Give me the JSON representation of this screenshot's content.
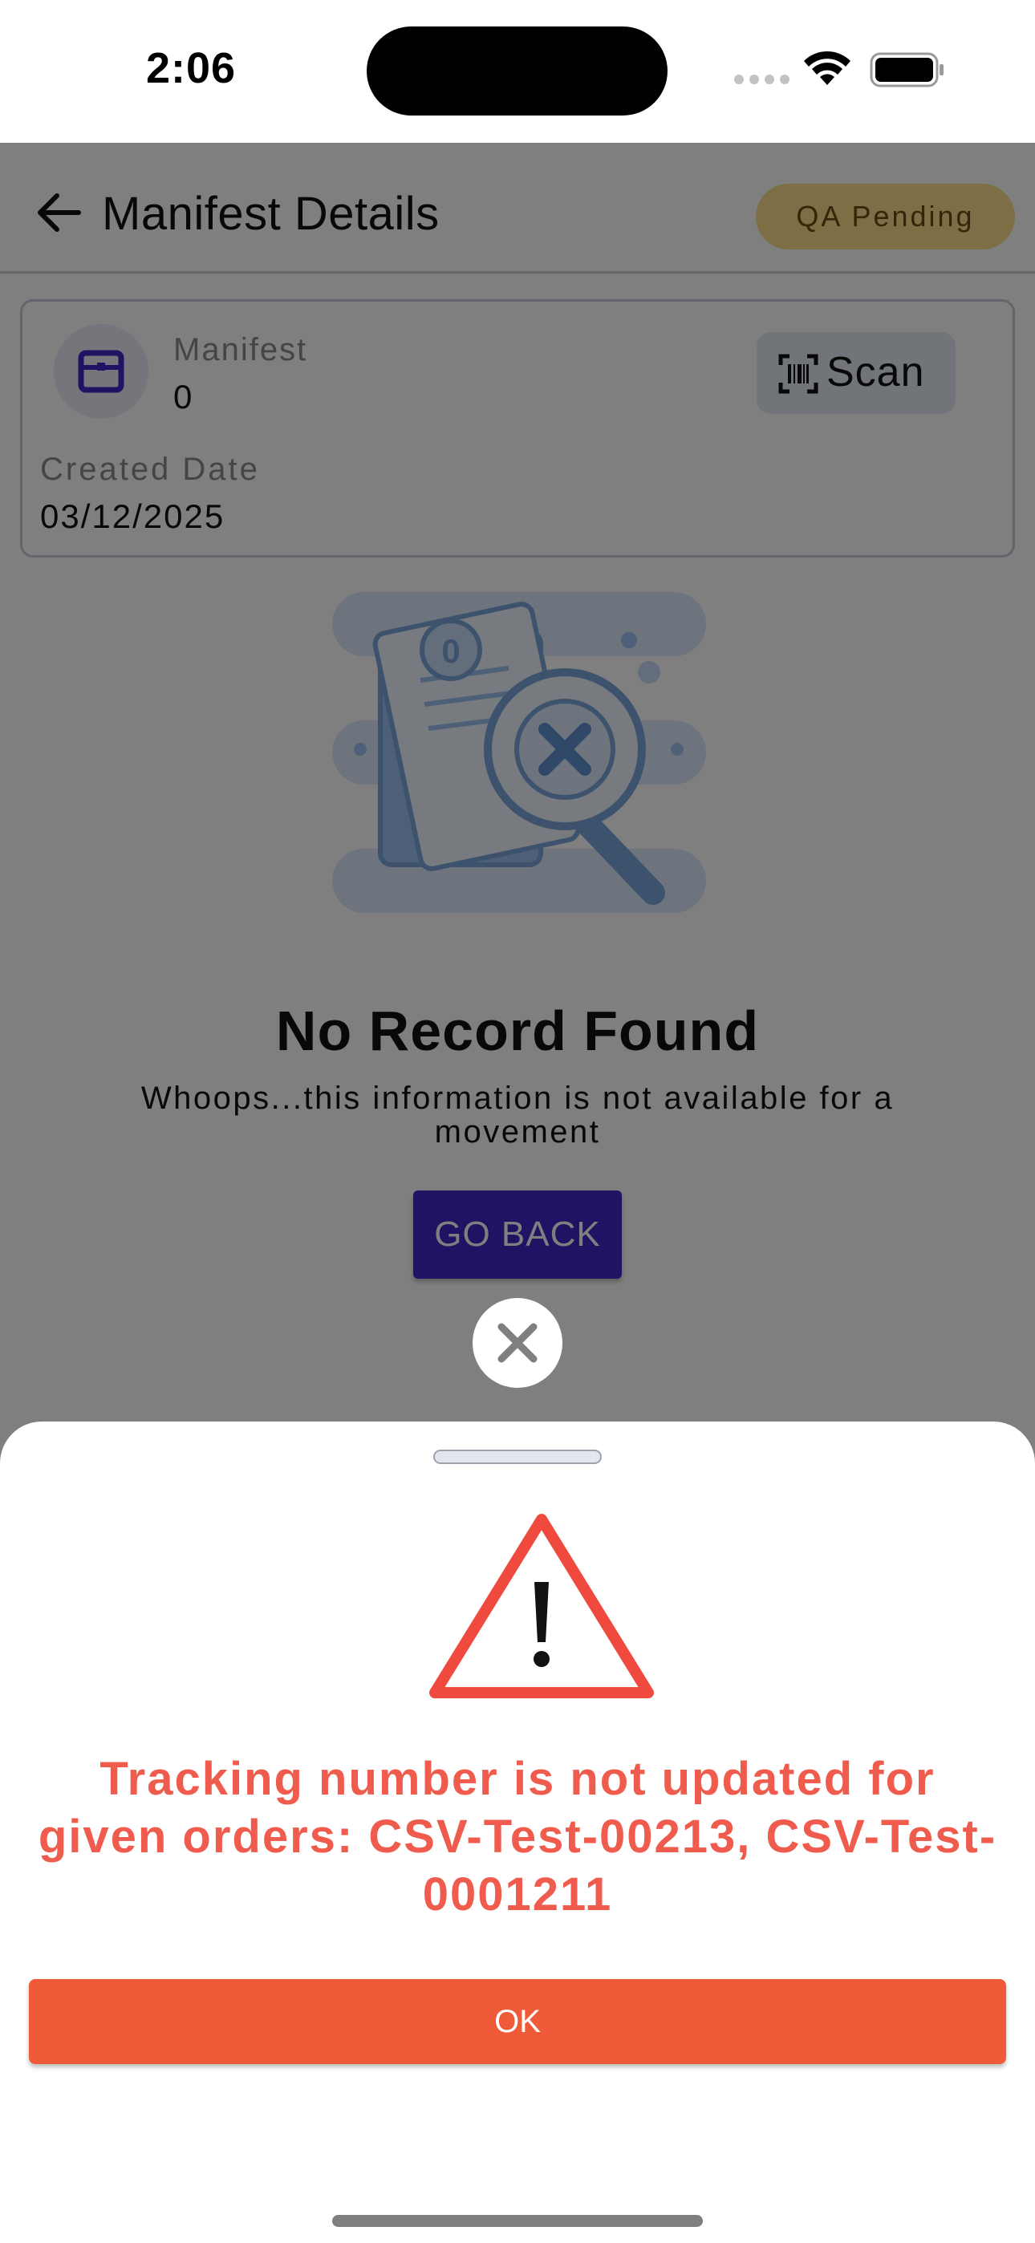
{
  "status_bar": {
    "time": "2:06"
  },
  "header": {
    "title": "Manifest Details",
    "status_badge": "QA Pending"
  },
  "manifest_card": {
    "manifest_label": "Manifest",
    "manifest_value": "0",
    "scan_label": "Scan",
    "created_label": "Created Date",
    "created_value": "03/12/2025"
  },
  "empty_state": {
    "title": "No Record Found",
    "description": "Whoops...this information is not available for a movement",
    "button_label": "GO BACK"
  },
  "alert_sheet": {
    "message": "Tracking number is not updated for given orders: CSV-Test-00213, CSV-Test-0001211",
    "ok_label": "OK"
  },
  "colors": {
    "primary": "#3f27c8",
    "badge_bg": "#fbdc8a",
    "error": "#ef5b4c",
    "ok_button": "#ef5a38"
  },
  "icons": [
    "back-arrow-icon",
    "box-icon",
    "barcode-scan-icon",
    "no-record-illustration",
    "close-icon",
    "warning-icon"
  ]
}
